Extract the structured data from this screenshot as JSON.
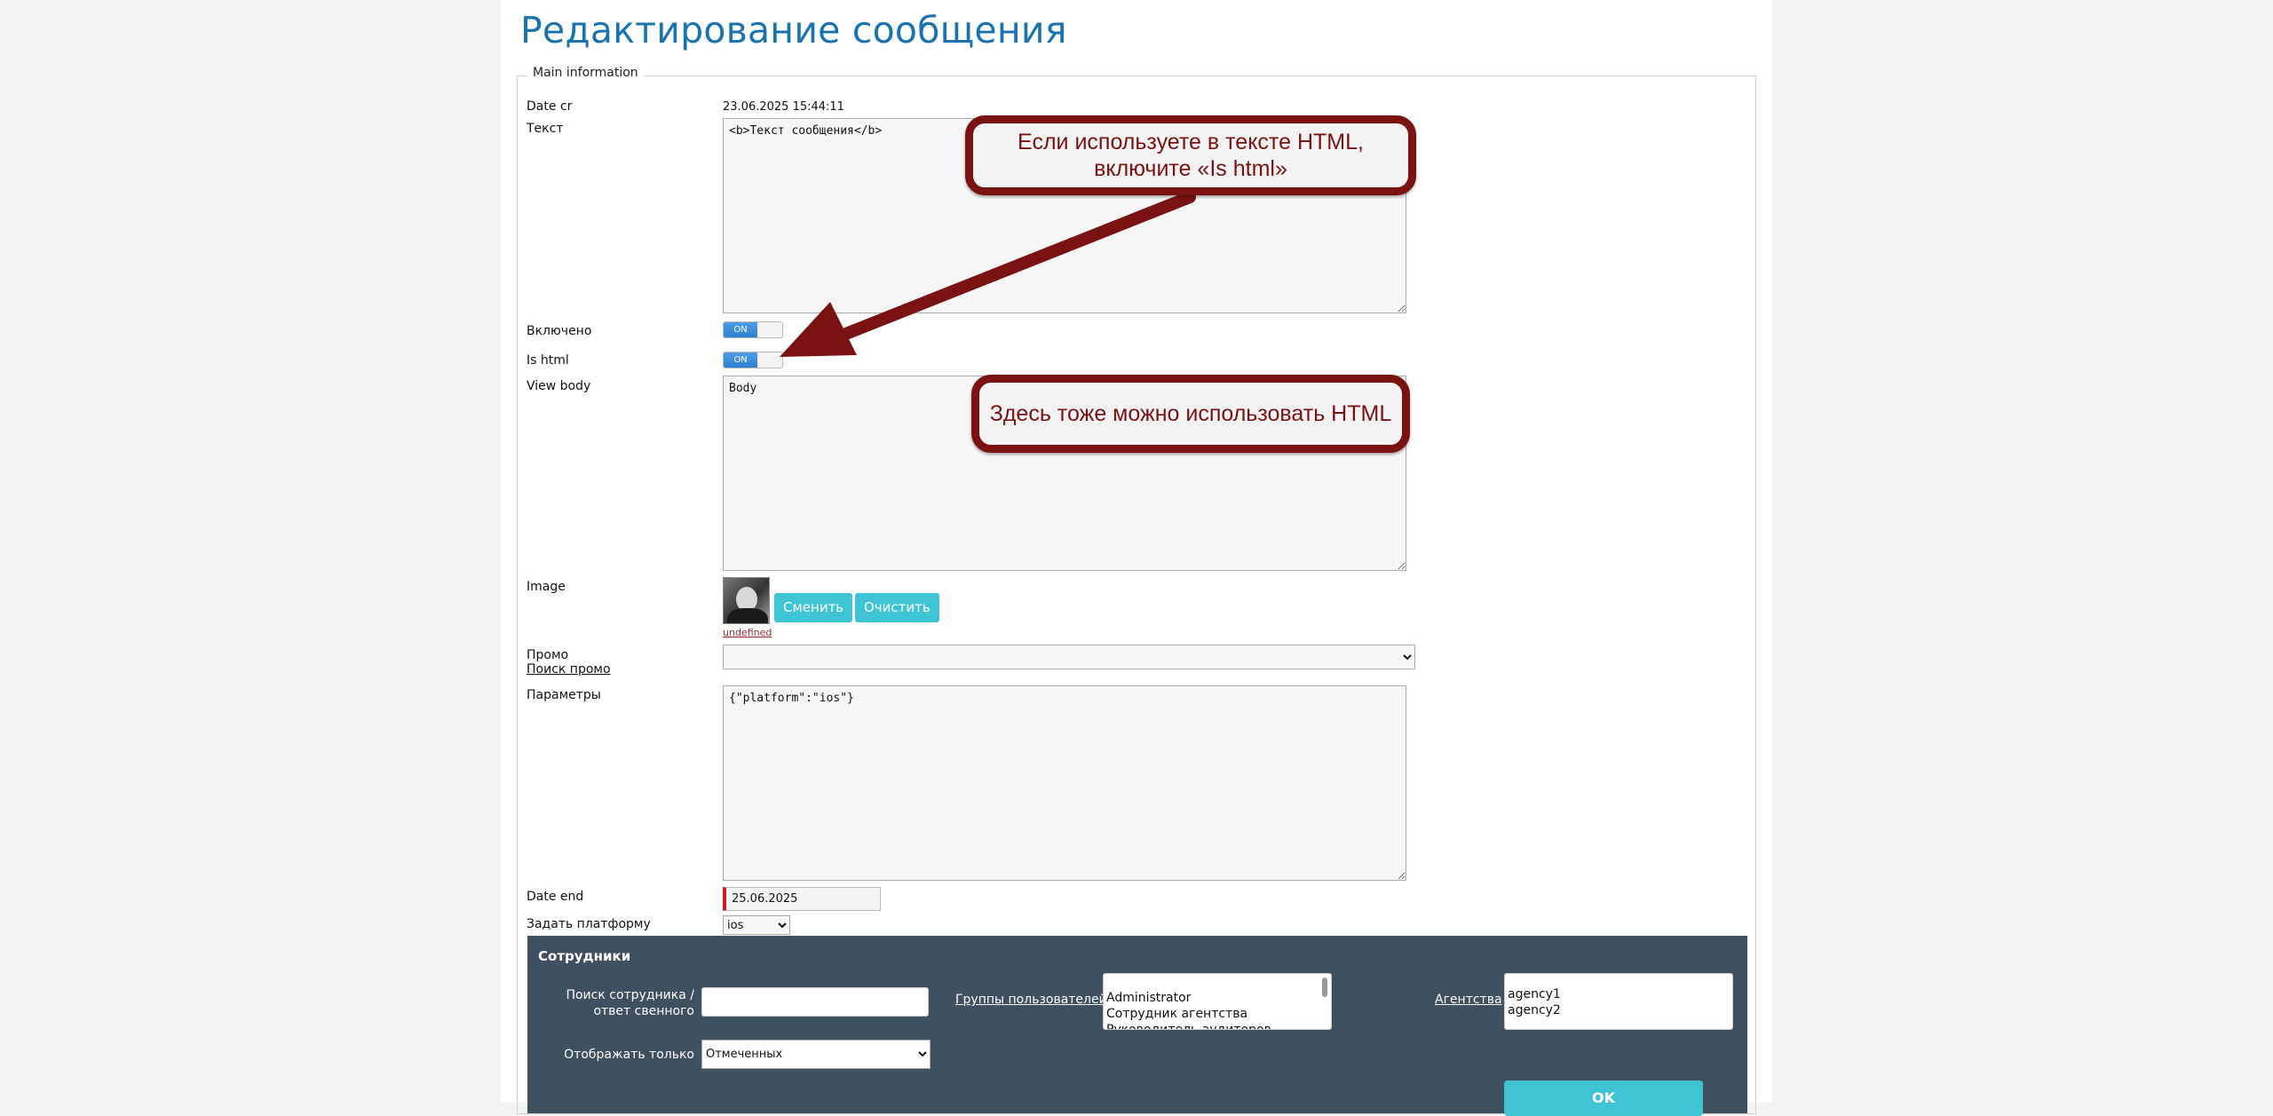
{
  "page": {
    "title": "Редактирование сообщения",
    "legend": "Main information"
  },
  "form": {
    "date_cr": {
      "label": "Date cr",
      "value": "23.06.2025 15:44:11"
    },
    "text": {
      "label": "Текст",
      "value": "<b>Текст сообщения</b>"
    },
    "enabled": {
      "label": "Включено",
      "state": "ON"
    },
    "is_html": {
      "label": "Is html",
      "state": "ON"
    },
    "view_body": {
      "label": "View body",
      "value": "Body"
    },
    "image": {
      "label": "Image",
      "change_label": "Сменить",
      "clear_label": "Очистить",
      "link_text": "undefined"
    },
    "promo": {
      "label": "Промо",
      "search_link": "Поиск промо",
      "value": ""
    },
    "params": {
      "label": "Параметры",
      "value": "{\"platform\":\"ios\"}"
    },
    "date_end": {
      "label": "Date end",
      "value": "25.06.2025"
    },
    "platform": {
      "label": "Задать платформу",
      "value": "ios"
    }
  },
  "employees": {
    "title": "Сотрудники",
    "search_label": "Поиск сотрудника / ответ свенного",
    "show_only_label": "Отображать только",
    "show_only_value": "Отмеченных",
    "groups_link": "Группы пользователей",
    "groups": [
      "Administrator",
      "Сотрудник агентства",
      "Руководитель аудиторов"
    ],
    "agencies_link": "Агентства",
    "agencies": [
      "agency1",
      "agency2"
    ],
    "ok_label": "OK"
  },
  "annotations": {
    "callout1": "Если используете в тексте HTML, включите «Is html»",
    "callout2": "Здесь тоже можно использовать HTML",
    "color": "#7a1212"
  }
}
